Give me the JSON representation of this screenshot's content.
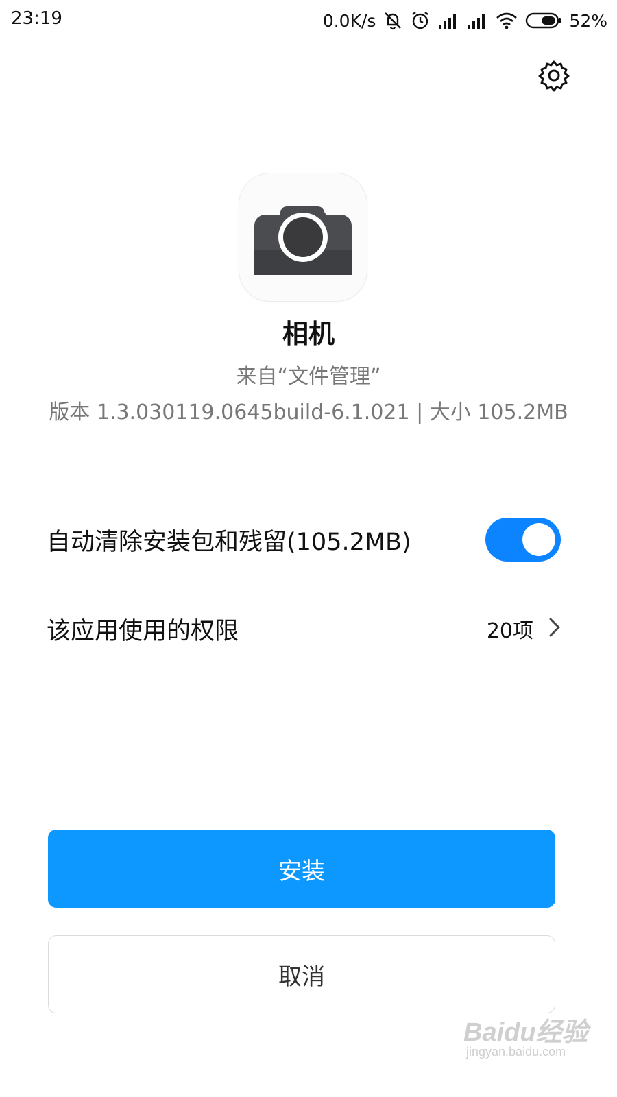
{
  "status_bar": {
    "time": "23:19",
    "net_speed": "0.0K/s",
    "battery_pct": "52%",
    "icons": [
      "mute-bell-icon",
      "alarm-icon",
      "signal-icon",
      "signal-icon",
      "wifi-icon",
      "battery-icon"
    ]
  },
  "header": {
    "settings_icon": "gear-icon"
  },
  "app": {
    "icon": "camera-icon",
    "name": "相机",
    "source": "来自“文件管理”",
    "meta": "版本 1.3.030119.0645build-6.1.021 | 大小 105.2MB"
  },
  "options": {
    "auto_clean_label": "自动清除安装包和残留(105.2MB)",
    "auto_clean_enabled": true,
    "permissions_label": "该应用使用的权限",
    "permissions_count": "20项"
  },
  "buttons": {
    "install": "安装",
    "cancel": "取消"
  },
  "watermark": {
    "brand": "Baidu经验",
    "url": "jingyan.baidu.com"
  },
  "colors": {
    "accent": "#0d98ff",
    "toggle_on": "#0d84ff"
  }
}
